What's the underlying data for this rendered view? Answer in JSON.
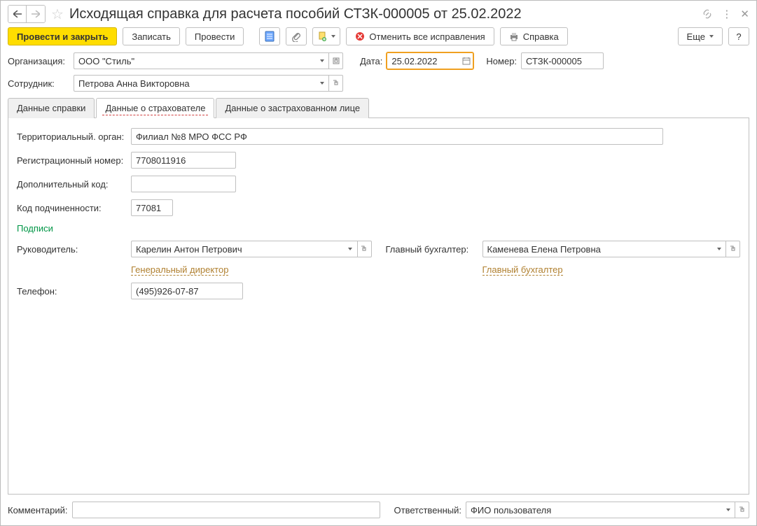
{
  "title": "Исходящая справка для расчета пособий СТЗК-000005 от 25.02.2022",
  "toolbar": {
    "post_close": "Провести и закрыть",
    "write": "Записать",
    "post": "Провести",
    "cancel_fix": "Отменить все исправления",
    "help": "Справка",
    "more": "Еще"
  },
  "header": {
    "org_label": "Организация:",
    "org_value": "ООО \"Стиль\"",
    "date_label": "Дата:",
    "date_value": "25.02.2022",
    "number_label": "Номер:",
    "number_value": "СТЗК-000005",
    "emp_label": "Сотрудник:",
    "emp_value": "Петрова Анна Викторовна"
  },
  "tabs": {
    "t1": "Данные справки",
    "t2": "Данные о страхователе",
    "t3": "Данные о застрахованном лице"
  },
  "insurer": {
    "territory_label": "Территориальный. орган:",
    "territory_value": "Филиал №8 МРО ФСС РФ",
    "regnum_label": "Регистрационный номер:",
    "regnum_value": "7708011916",
    "addcode_label": "Дополнительный код:",
    "addcode_value": "",
    "subcode_label": "Код подчиненности:",
    "subcode_value": "77081",
    "sign_title": "Подписи",
    "head_label": "Руководитель:",
    "head_value": "Карелин Антон Петрович",
    "head_position": "Генеральный директор",
    "acc_label": "Главный бухгалтер:",
    "acc_value": "Каменева Елена Петровна",
    "acc_position": "Главный бухгалтер",
    "phone_label": "Телефон:",
    "phone_value": "(495)926-07-87"
  },
  "footer": {
    "comment_label": "Комментарий:",
    "comment_value": "",
    "resp_label": "Ответственный:",
    "resp_value": "ФИО пользователя"
  }
}
